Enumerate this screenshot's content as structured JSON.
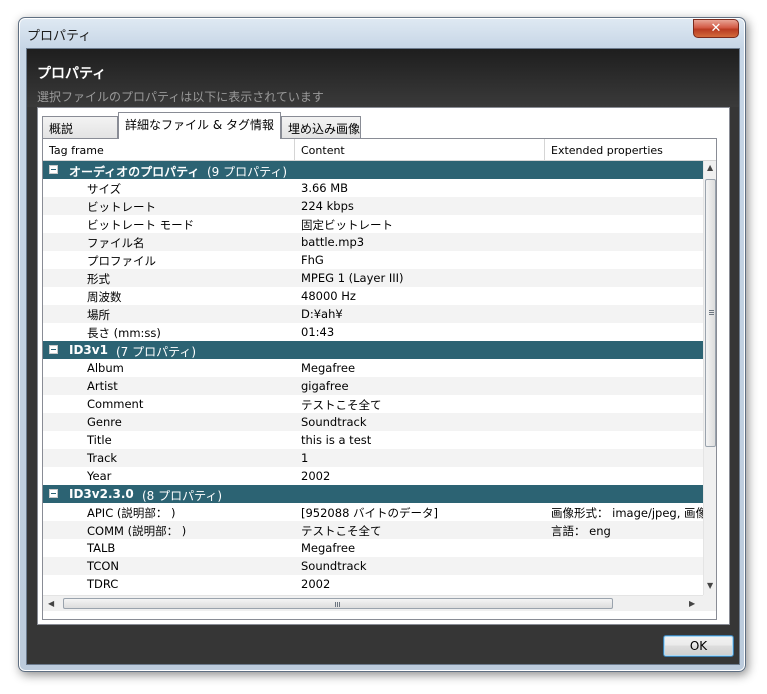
{
  "window": {
    "title": "プロパティ",
    "close_glyph": "✕"
  },
  "header": {
    "title": "プロパティ",
    "subtitle": "選択ファイルのプロパティは以下に表示されています"
  },
  "tabs": [
    {
      "label": "概説",
      "active": false
    },
    {
      "label": "詳細なファイル & タグ情報",
      "active": true
    },
    {
      "label": "埋め込み画像",
      "active": false
    }
  ],
  "grid": {
    "columns": [
      "Tag frame",
      "Content",
      "Extended properties"
    ],
    "groups": [
      {
        "name": "オーディオのプロパティ",
        "count": "(9 プロパティ)",
        "rows": [
          [
            "サイズ",
            "3.66 MB",
            ""
          ],
          [
            "ビットレート",
            "224 kbps",
            ""
          ],
          [
            "ビットレート モード",
            "固定ビットレート",
            ""
          ],
          [
            "ファイル名",
            "battle.mp3",
            ""
          ],
          [
            "プロファイル",
            "FhG",
            ""
          ],
          [
            "形式",
            "MPEG 1 (Layer III)",
            ""
          ],
          [
            "周波数",
            "48000 Hz",
            ""
          ],
          [
            "場所",
            "D:¥ah¥",
            ""
          ],
          [
            "長さ (mm:ss)",
            "01:43",
            ""
          ]
        ]
      },
      {
        "name": "ID3v1",
        "count": "(7 プロパティ)",
        "rows": [
          [
            "Album",
            "Megafree",
            ""
          ],
          [
            "Artist",
            "gigafree",
            ""
          ],
          [
            "Comment",
            "テストこそ全て",
            ""
          ],
          [
            "Genre",
            "Soundtrack",
            ""
          ],
          [
            "Title",
            "this is a test",
            ""
          ],
          [
            "Track",
            "1",
            ""
          ],
          [
            "Year",
            "2002",
            ""
          ]
        ]
      },
      {
        "name": "ID3v2.3.0",
        "count": "(8 プロパティ)",
        "rows": [
          [
            "APIC (説明部： )",
            "[952088 バイトのデータ]",
            "画像形式： image/jpeg, 画像"
          ],
          [
            "COMM (説明部： )",
            "テストこそ全て",
            "言語： eng"
          ],
          [
            "TALB",
            "Megafree",
            ""
          ],
          [
            "TCON",
            "Soundtrack",
            ""
          ],
          [
            "TDRC",
            "2002",
            ""
          ]
        ]
      }
    ]
  },
  "scrollbars": {
    "up": "▲",
    "down": "▼",
    "left": "◀",
    "right": "▶"
  },
  "ok_button": "OK",
  "colors": {
    "group_header_bg": "#2c6373",
    "client_bg": "#363636",
    "accent_border": "#3c7fb1"
  }
}
